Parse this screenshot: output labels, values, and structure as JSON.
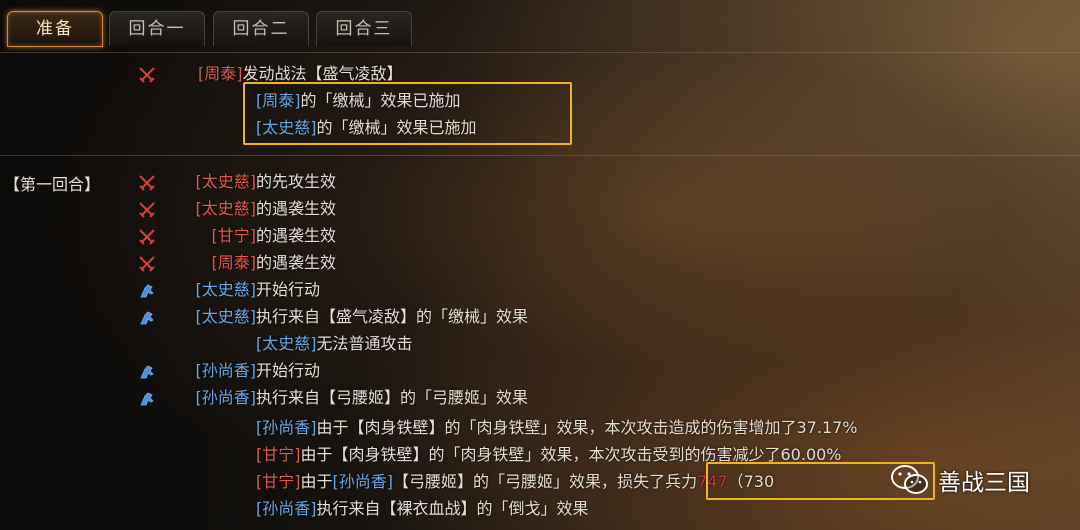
{
  "tabs": [
    {
      "label": "准备",
      "active": true
    },
    {
      "label": "回合一",
      "active": false
    },
    {
      "label": "回合二",
      "active": false
    },
    {
      "label": "回合三",
      "active": false
    }
  ],
  "prep_block": {
    "line1": {
      "icon": "crossed-swords-icon",
      "name": "周泰",
      "text": "发动战法【盛气凌敌】"
    },
    "line2": {
      "name": "周泰",
      "text": "的「缴械」效果已施加"
    },
    "line3": {
      "name": "太史慈",
      "text": "的「缴械」效果已施加"
    }
  },
  "round_label": "【第一回合】",
  "round_lines": [
    {
      "icon": "crossed-swords-icon",
      "name": "太史慈",
      "name_color": "red",
      "text": "的先攻生效"
    },
    {
      "icon": "crossed-swords-icon",
      "name": "太史慈",
      "name_color": "red",
      "text": "的遇袭生效"
    },
    {
      "icon": "crossed-swords-icon",
      "name": "甘宁",
      "name_color": "red",
      "text": "的遇袭生效"
    },
    {
      "icon": "crossed-swords-icon",
      "name": "周泰",
      "name_color": "red",
      "text": "的遇袭生效"
    },
    {
      "icon": "horse-icon",
      "name": "太史慈",
      "name_color": "blue",
      "text": "开始行动"
    },
    {
      "icon": "horse-icon",
      "name": "太史慈",
      "name_color": "blue",
      "text": "执行来自【盛气凌敌】的「缴械」效果"
    },
    {
      "icon": "",
      "name": "太史慈",
      "name_color": "blue",
      "text": "无法普通攻击"
    },
    {
      "icon": "horse-icon",
      "name": "孙尚香",
      "name_color": "blue",
      "text": "开始行动"
    },
    {
      "icon": "horse-icon",
      "name": "孙尚香",
      "name_color": "blue",
      "text": "执行来自【弓腰姬】的「弓腰姬」效果"
    },
    {
      "icon": "",
      "name": "孙尚香",
      "name_color": "blue",
      "text": "由于【肉身铁壁】的「肉身铁壁」效果，本次攻击造成的伤害增加了37.17%"
    },
    {
      "icon": "",
      "name": "甘宁",
      "name_color": "red",
      "text": "由于【肉身铁壁】的「肉身铁壁」效果，本次攻击受到的伤害减少了60.00%"
    }
  ],
  "damage_line": {
    "name": "甘宁",
    "mid_name": "孙尚香",
    "text1": "由于",
    "text2": "【弓腰姬】的「弓腰姬」效果，",
    "loss_prefix": "损失了兵力",
    "loss_value": "747",
    "remaining": "（730",
    "close": "）"
  },
  "last_line": {
    "name": "孙尚香",
    "text": "执行来自【裸衣血战】的「倒戈」效果"
  },
  "watermark": {
    "icon": "wechat-icon",
    "text": "善战三国"
  }
}
